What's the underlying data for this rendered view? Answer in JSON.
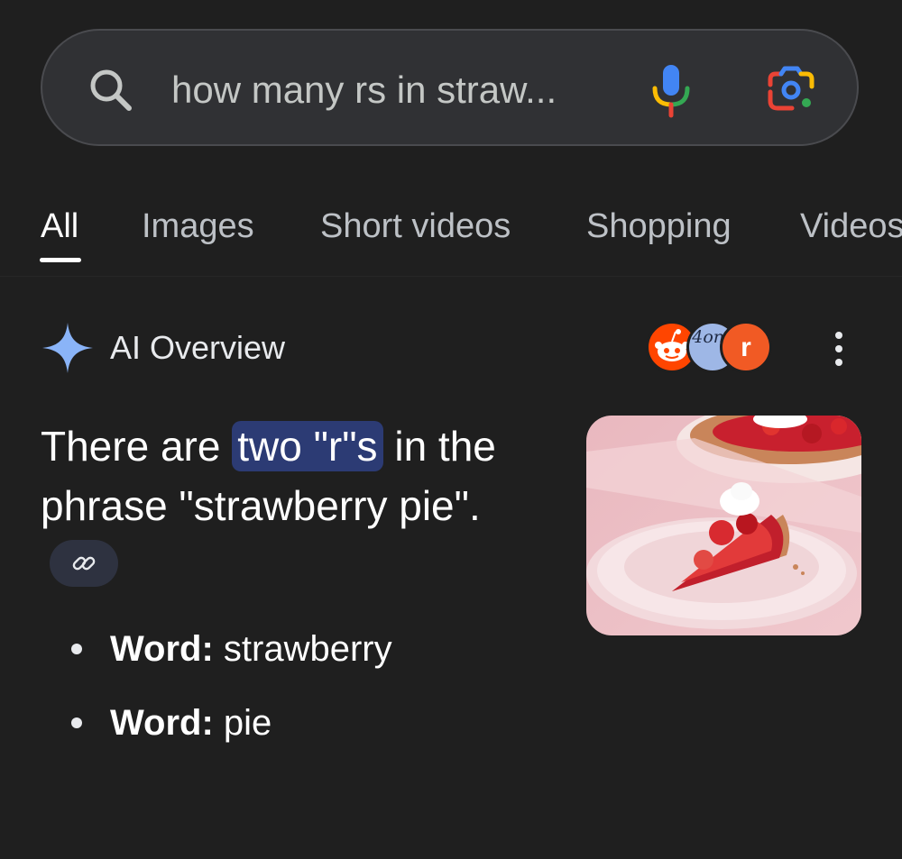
{
  "search": {
    "query": "how many rs in straw..."
  },
  "tabs": [
    {
      "label": "All",
      "selected": true
    },
    {
      "label": "Images"
    },
    {
      "label": "Short videos"
    },
    {
      "label": "Shopping"
    },
    {
      "label": "Videos"
    }
  ],
  "ai_overview": {
    "title": "AI Overview",
    "sources": [
      {
        "icon": "reddit-alien-icon",
        "color": "#ff4500"
      },
      {
        "text": "4ons",
        "color": "#9eb7e6"
      },
      {
        "text": "r",
        "color": "#f15a24"
      }
    ],
    "answer": {
      "prefix": "There are ",
      "highlight": "two \"r\"s",
      "suffix": " in the phrase \"strawberry pie\"."
    },
    "bullets": [
      {
        "label": "Word:",
        "value": " strawberry"
      },
      {
        "label": "Word:",
        "value": " pie"
      }
    ],
    "image": {
      "subject": "slice of strawberry pie with whipped cream on a pink plate"
    }
  },
  "colors": {
    "background": "#1f1f1f",
    "search_bar": "#303134",
    "highlight": "#2c3b74",
    "sparkle": "#8ab4f8"
  }
}
